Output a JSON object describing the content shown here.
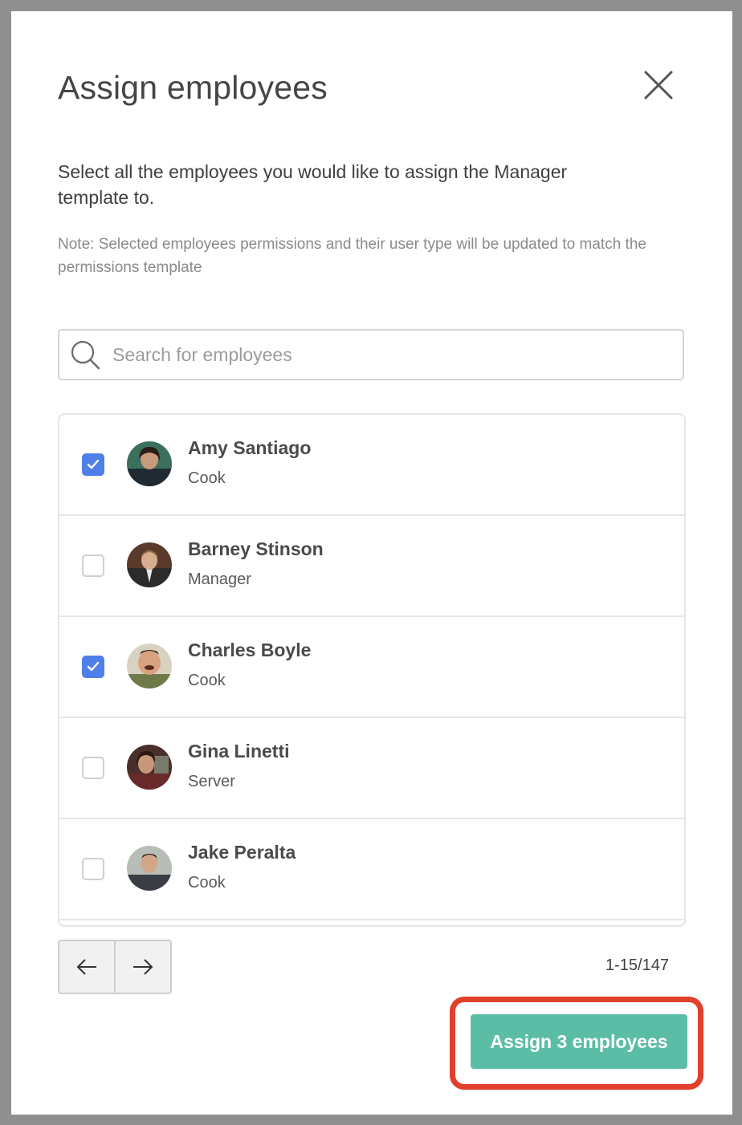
{
  "dialog": {
    "title": "Assign employees",
    "description": "Select all the employees you would like to assign the Manager template to.",
    "note": "Note: Selected employees permissions and their user type will be updated to match the permissions template",
    "close_icon": "close-icon"
  },
  "search": {
    "placeholder": "Search for employees",
    "value": "",
    "icon": "search-icon"
  },
  "employees": [
    {
      "name": "Amy Santiago",
      "role": "Cook",
      "checked": true
    },
    {
      "name": "Barney Stinson",
      "role": "Manager",
      "checked": false
    },
    {
      "name": "Charles Boyle",
      "role": "Cook",
      "checked": true
    },
    {
      "name": "Gina Linetti",
      "role": "Server",
      "checked": false
    },
    {
      "name": "Jake Peralta",
      "role": "Cook",
      "checked": false
    }
  ],
  "pagination": {
    "prev_icon": "arrow-left-icon",
    "next_icon": "arrow-right-icon",
    "range": "1-15/147"
  },
  "actions": {
    "assign_label": "Assign 3 employees"
  },
  "colors": {
    "accent": "#5cbda7",
    "checkbox_checked": "#4f7fe8",
    "highlight": "#e0402c"
  }
}
